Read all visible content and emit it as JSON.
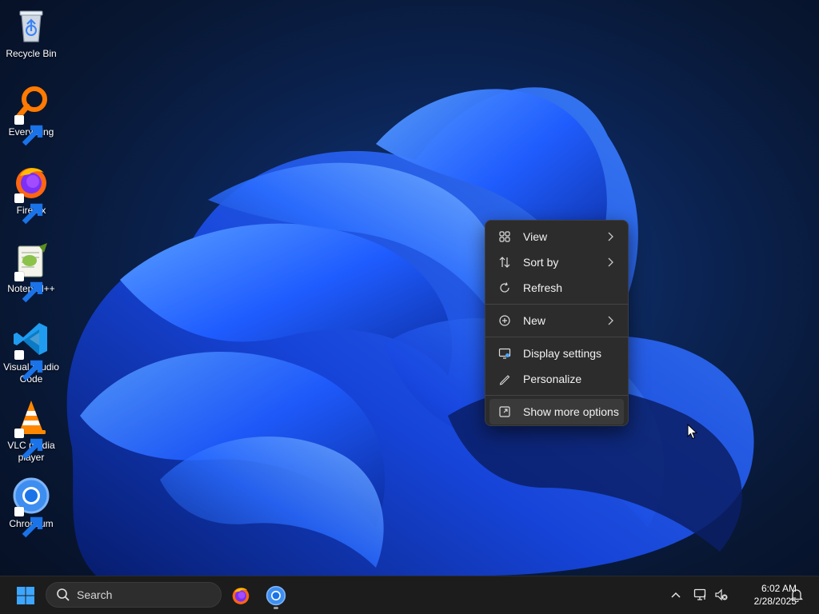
{
  "desktop": {
    "icons": [
      {
        "label": "Recycle Bin",
        "icon": "recycle-bin-icon"
      },
      {
        "label": "Everything",
        "icon": "everything-search-icon"
      },
      {
        "label": "Firefox",
        "icon": "firefox-icon"
      },
      {
        "label": "Notepad++",
        "icon": "notepad-plus-plus-icon"
      },
      {
        "label": "Visual Studio Code",
        "icon": "vscode-icon"
      },
      {
        "label": "VLC media player",
        "icon": "vlc-icon"
      },
      {
        "label": "Chromium",
        "icon": "chromium-icon"
      }
    ]
  },
  "context_menu": {
    "items": [
      {
        "label": "View",
        "icon": "grid-view-icon",
        "submenu": true
      },
      {
        "label": "Sort by",
        "icon": "sort-icon",
        "submenu": true
      },
      {
        "label": "Refresh",
        "icon": "refresh-icon",
        "submenu": false
      },
      {
        "label": "New",
        "icon": "plus-circle-icon",
        "submenu": true
      },
      {
        "label": "Display settings",
        "icon": "display-settings-icon",
        "submenu": false
      },
      {
        "label": "Personalize",
        "icon": "pen-icon",
        "submenu": false
      },
      {
        "label": "Show more options",
        "icon": "show-more-options-icon",
        "submenu": false,
        "hovered": true
      }
    ]
  },
  "taskbar": {
    "start_icon": "windows-start-icon",
    "search": {
      "placeholder": "Search",
      "icon": "search-icon"
    },
    "apps": [
      {
        "name": "Firefox",
        "icon": "firefox-icon",
        "running": false
      },
      {
        "name": "Chromium",
        "icon": "chromium-icon",
        "running": true
      }
    ],
    "tray": {
      "overflow_icon": "chevron-up-icon",
      "network_icon": "network-icon",
      "volume_icon": "volume-muted-icon",
      "notification_icon": "bell-icon"
    },
    "clock": {
      "time": "6:02 AM",
      "date": "2/28/2025"
    }
  },
  "colors": {
    "accent": "#0078d4",
    "menu_bg": "#2c2c2c",
    "taskbar_bg": "#1c1c1c",
    "wallpaper_blue": "#1f5cff"
  }
}
